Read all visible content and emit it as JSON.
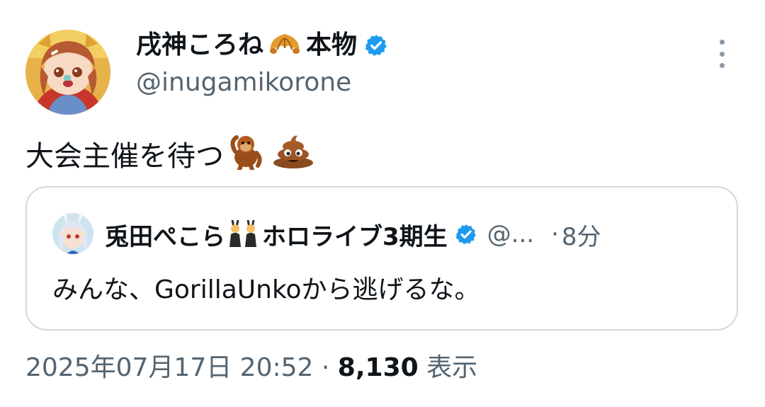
{
  "author": {
    "display_name": "戌神ころね",
    "display_name_suffix": "本物",
    "handle": "@inugamikorone",
    "name_emoji": "croissant",
    "verified": true
  },
  "tweet": {
    "text": "大会主催を待つ",
    "emojis": [
      "orangutan",
      "pile-of-poo"
    ]
  },
  "quoted_tweet": {
    "display_name_prefix": "兎田ぺこら",
    "display_name_suffix": "ホロライブ3期生",
    "name_emoji": "women-with-bunny-ears",
    "handle": "@...",
    "separator": "·",
    "time": "8分",
    "text": "みんな、GorillaUnkoから逃げるな。"
  },
  "meta": {
    "datetime": "2025年07月17日 20:52",
    "separator": "·",
    "views_count": "8,130",
    "views_label": "表示"
  },
  "colors": {
    "text": "#0f1419",
    "secondary": "#536471",
    "verified_blue": "#1d9bf0",
    "border": "#cfd9de"
  }
}
